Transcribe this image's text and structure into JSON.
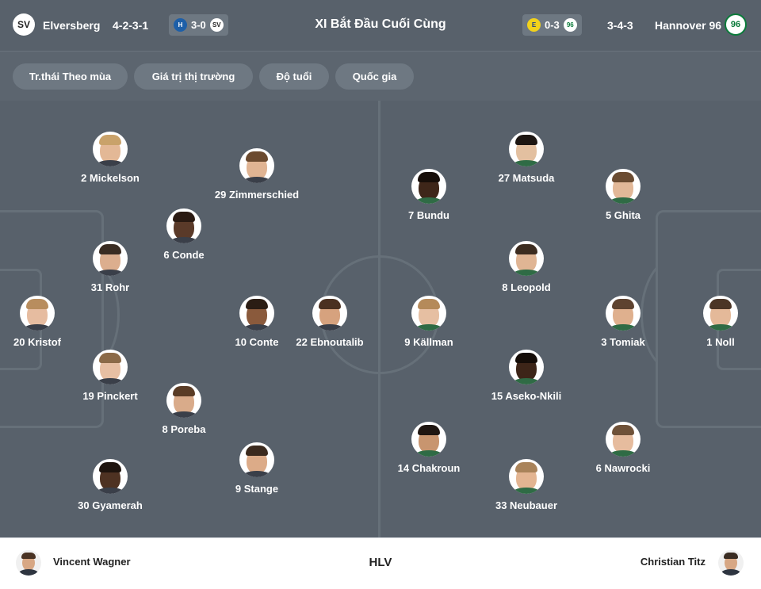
{
  "header": {
    "home_team": "Elversberg",
    "home_formation": "4-2-3-1",
    "home_score": "3-0",
    "title": "XI Bắt Đầu Cuối Cùng",
    "away_score": "0-3",
    "away_formation": "3-4-3",
    "away_team": "Hannover 96",
    "home_logo_text": "SV",
    "away_logo_text": "96"
  },
  "tabs": [
    "Tr.thái Theo mùa",
    "Giá trị thị trường",
    "Độ tuổi",
    "Quốc gia"
  ],
  "home_players": [
    {
      "label": "2 Mickelson"
    },
    {
      "label": "29 Zimmerschied"
    },
    {
      "label": "6 Conde"
    },
    {
      "label": "31 Rohr"
    },
    {
      "label": "20 Kristof"
    },
    {
      "label": "10 Conte"
    },
    {
      "label": "22 Ebnoutalib"
    },
    {
      "label": "19 Pinckert"
    },
    {
      "label": "8 Poreba"
    },
    {
      "label": "9 Stange"
    },
    {
      "label": "30 Gyamerah"
    }
  ],
  "away_players": [
    {
      "label": "27 Matsuda"
    },
    {
      "label": "7 Bundu"
    },
    {
      "label": "5 Ghita"
    },
    {
      "label": "8 Leopold"
    },
    {
      "label": "9 Källman"
    },
    {
      "label": "3 Tomiak"
    },
    {
      "label": "1 Noll"
    },
    {
      "label": "15 Aseko-Nkili"
    },
    {
      "label": "14 Chakroun"
    },
    {
      "label": "6 Nawrocki"
    },
    {
      "label": "33 Neubauer"
    }
  ],
  "coaches": {
    "home": "Vincent Wagner",
    "label": "HLV",
    "away": "Christian Titz"
  },
  "colors": {
    "pitch": "#58616b",
    "header": "#58616b",
    "tab_bg": "#6e7882",
    "pitch_lines": "#667079",
    "hannover_green": "#0a7a3a"
  }
}
